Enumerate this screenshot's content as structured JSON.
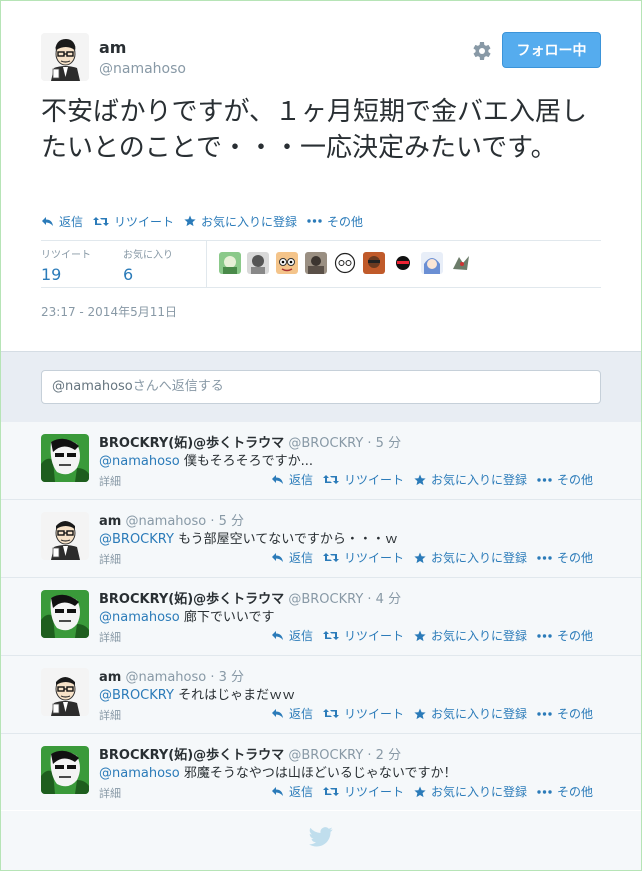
{
  "tweet": {
    "name": "am",
    "handle": "@namahoso",
    "follow_label": "フォロー中",
    "text": "不安ばかりですが、１ヶ月短期で金バエ入居したいとのことで・・・一応決定みたいです。",
    "actions": {
      "reply": "返信",
      "retweet": "リツイート",
      "favorite": "お気に入りに登録",
      "more": "その他"
    },
    "stats": {
      "retweets_label": "リツイート",
      "retweets": "19",
      "favorites_label": "お気に入り",
      "favorites": "6"
    },
    "timestamp": "23:17 - 2014年5月11日"
  },
  "reply_box": {
    "mention": "@namahoso",
    "placeholder_suffix": "さんへ返信する"
  },
  "replies": [
    {
      "name": "BROCKRY(妬)@歩くトラウマ",
      "handle": "@BROCKRY",
      "time": "5 分",
      "mention": "@namahoso",
      "text": " 僕もそろそろですか...",
      "detail": "詳細",
      "avatar": "brockry"
    },
    {
      "name": "am",
      "handle": "@namahoso",
      "time": "5 分",
      "mention": "@BROCKRY",
      "text": " もう部屋空いてないですから・・・ｗ",
      "detail": "詳細",
      "avatar": "am"
    },
    {
      "name": "BROCKRY(妬)@歩くトラウマ",
      "handle": "@BROCKRY",
      "time": "4 分",
      "mention": "@namahoso",
      "text": " 廊下でいいです",
      "detail": "詳細",
      "avatar": "brockry"
    },
    {
      "name": "am",
      "handle": "@namahoso",
      "time": "3 分",
      "mention": "@BROCKRY",
      "text": " それはじゃまだｗｗ",
      "detail": "詳細",
      "avatar": "am"
    },
    {
      "name": "BROCKRY(妬)@歩くトラウマ",
      "handle": "@BROCKRY",
      "time": "2 分",
      "mention": "@namahoso",
      "text": " 邪魔そうなやつは山ほどいるじゃないですか！",
      "detail": "詳細",
      "avatar": "brockry"
    }
  ],
  "colors": {
    "accent": "#55acee",
    "link": "#2b7bb9",
    "muted": "#8899a6"
  }
}
